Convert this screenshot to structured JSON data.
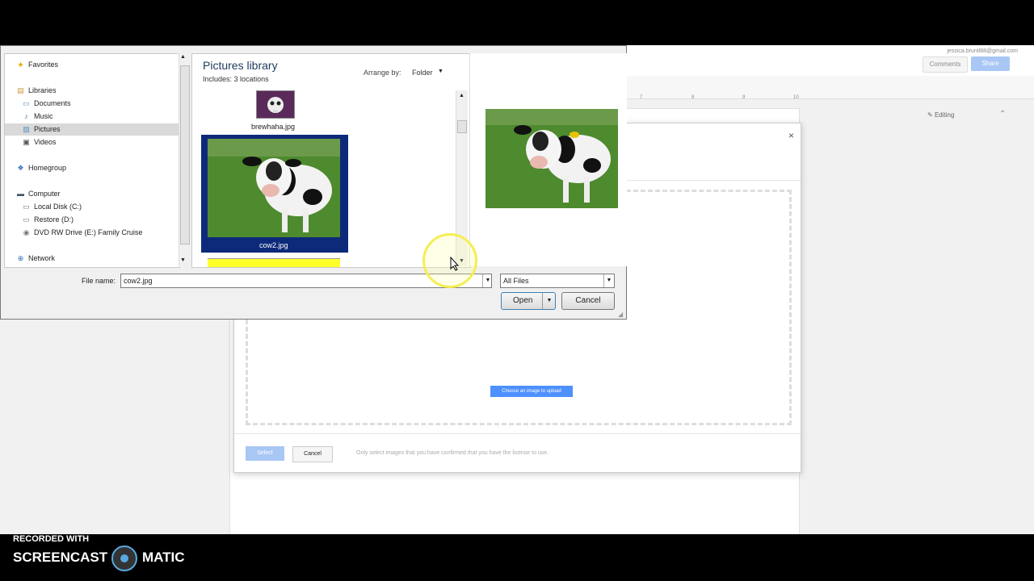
{
  "gdocs": {
    "account_email": "jessica.bruntl88@gmail.com",
    "comments": "Comments",
    "share": "Share",
    "editing": "Editing",
    "ruler_marks": [
      "7",
      "8",
      "9",
      "10"
    ],
    "insert_dialog": {
      "close": "×",
      "upload_button": "Choose an image to upload",
      "select_button": "Select",
      "cancel_button": "Cancel",
      "license_note": "Only select images that you have confirmed that you have the license to use."
    }
  },
  "file_dialog": {
    "nav": [
      {
        "label": "Favorites",
        "icon": "star-icon"
      },
      {
        "label": "Libraries",
        "icon": "library-icon"
      },
      {
        "label": "Documents",
        "icon": "documents-icon"
      },
      {
        "label": "Music",
        "icon": "music-icon"
      },
      {
        "label": "Pictures",
        "icon": "pictures-icon"
      },
      {
        "label": "Videos",
        "icon": "videos-icon"
      },
      {
        "label": "Homegroup",
        "icon": "homegroup-icon"
      },
      {
        "label": "Computer",
        "icon": "computer-icon"
      },
      {
        "label": "Local Disk (C:)",
        "icon": "disk-icon"
      },
      {
        "label": "Restore (D:)",
        "icon": "disk-icon"
      },
      {
        "label": "DVD RW Drive (E:) Family Cruise",
        "icon": "dvd-icon"
      },
      {
        "label": "Network",
        "icon": "network-icon"
      }
    ],
    "library_title": "Pictures library",
    "library_includes_label": "Includes:",
    "library_includes_value": "3 locations",
    "arrange_label": "Arrange by:",
    "arrange_value": "Folder",
    "files": [
      {
        "name": "brewhaha.jpg"
      },
      {
        "name": "cow2.jpg"
      }
    ],
    "filename_label": "File name:",
    "filename_value": "cow2.jpg",
    "filetype_value": "All Files",
    "open_button": "Open",
    "cancel_button": "Cancel"
  },
  "watermark": {
    "recorded_with": "RECORDED WITH",
    "brand_left": "SCREENCAST",
    "brand_right": "MATIC"
  }
}
